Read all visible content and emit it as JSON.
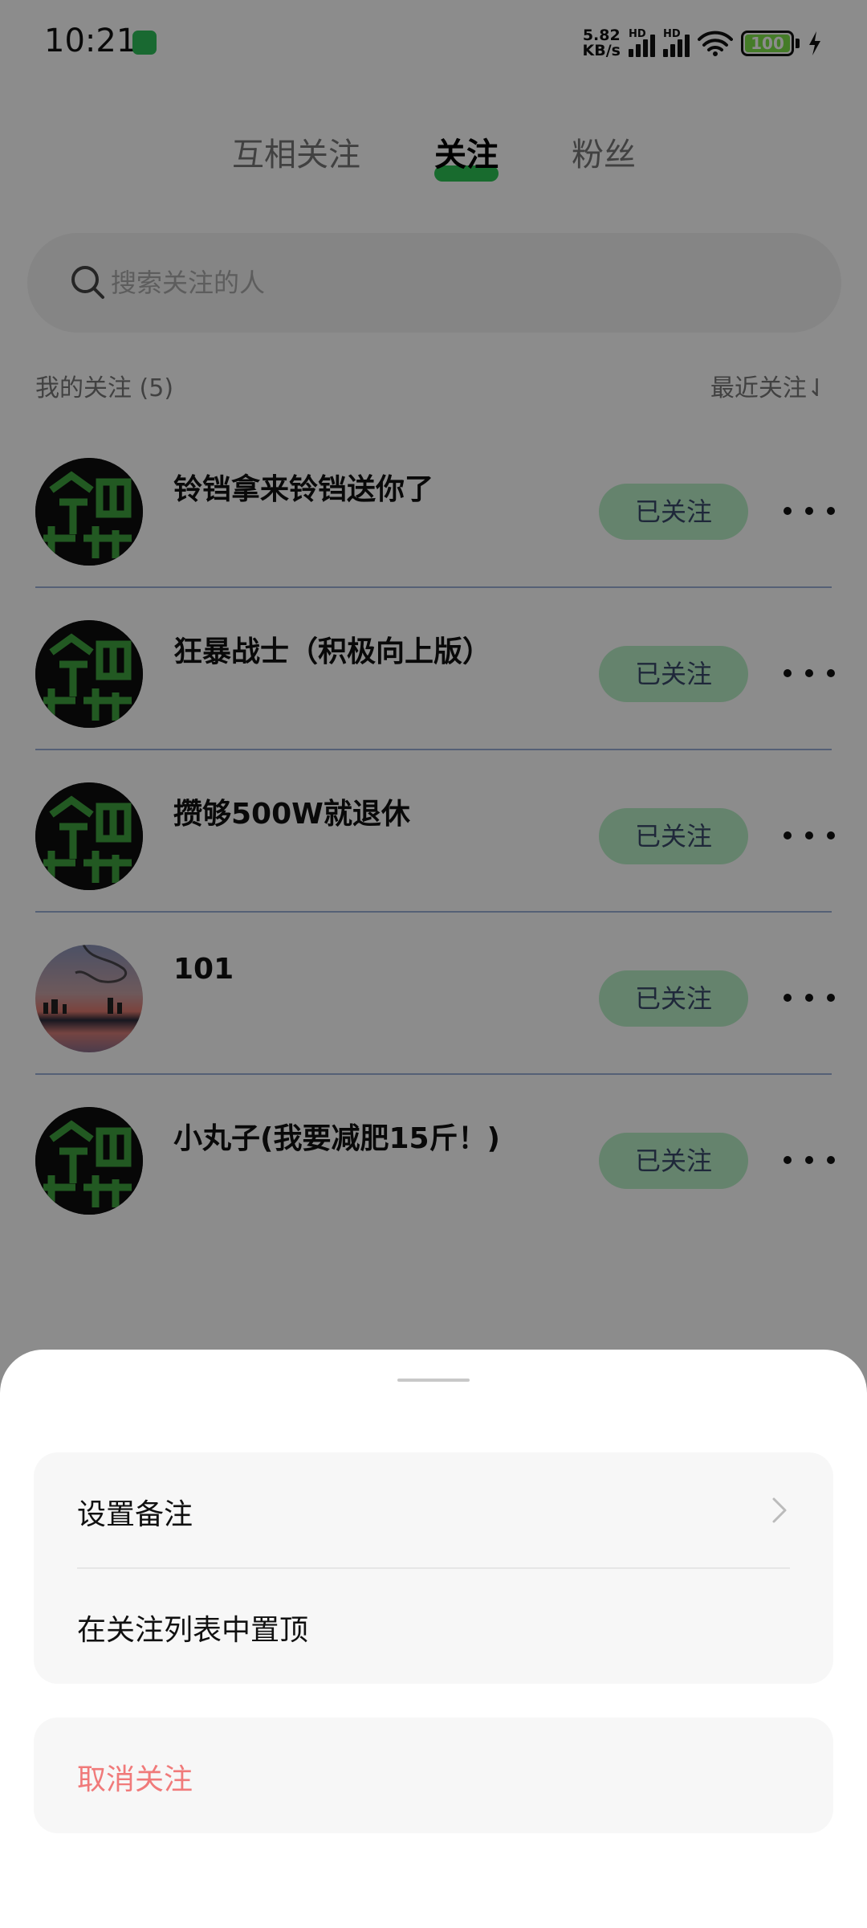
{
  "status_bar": {
    "time": "10:21",
    "net_speed_value": "5.82",
    "net_speed_unit": "KB/s",
    "signal_label_1": "HD",
    "signal_label_2": "HD",
    "battery_level": "100",
    "battery_color": "#7ee24a"
  },
  "tabs": [
    {
      "label": "互相关注",
      "active": false
    },
    {
      "label": "关注",
      "active": true
    },
    {
      "label": "粉丝",
      "active": false
    }
  ],
  "search": {
    "placeholder": "搜索关注的人"
  },
  "section": {
    "title": "我的关注 (5)",
    "sort_label": "最近关注⇃"
  },
  "follow_list": [
    {
      "name": "铃铛拿来铃铛送你了",
      "button": "已关注",
      "avatar": "app-logo"
    },
    {
      "name": "狂暴战士（积极向上版）",
      "button": "已关注",
      "avatar": "app-logo"
    },
    {
      "name": "攒够500W就退休",
      "button": "已关注",
      "avatar": "app-logo"
    },
    {
      "name": "101",
      "button": "已关注",
      "avatar": "sunset-photo"
    },
    {
      "name": "小丸子(我要减肥15斤！)",
      "button": "已关注",
      "avatar": "app-logo"
    }
  ],
  "sheet": {
    "set_note": "设置备注",
    "pin_top": "在关注列表中置顶",
    "unfollow": "取消关注"
  },
  "colors": {
    "accent": "#2dc455",
    "follow_button_bg": "#b9efc7",
    "danger_text": "#f07a7a"
  }
}
